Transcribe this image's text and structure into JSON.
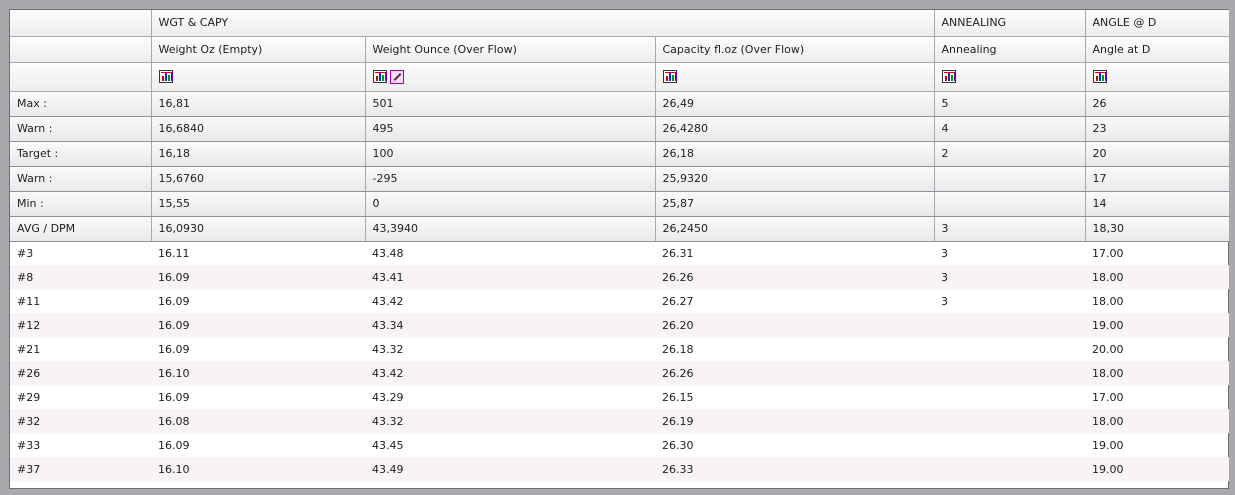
{
  "groups": {
    "wgt": "WGT & CAPY",
    "annealing": "ANNEALING",
    "angle": "ANGLE @ D"
  },
  "columns": [
    "Weight Oz (Empty)",
    "Weight Ounce (Over Flow)",
    "Capacity fl.oz (Over Flow)",
    "Annealing",
    "Angle at D"
  ],
  "icons": {
    "chart": "bar-chart-icon",
    "edit": "edit-notes-icon"
  },
  "stats": [
    {
      "label": "Max :",
      "values": [
        "16,81",
        "501",
        "26,49",
        "5",
        "26"
      ]
    },
    {
      "label": "Warn :",
      "values": [
        "16,6840",
        "495",
        "26,4280",
        "4",
        "23"
      ]
    },
    {
      "label": "Target :",
      "values": [
        "16,18",
        "100",
        "26,18",
        "2",
        "20"
      ]
    },
    {
      "label": "Warn :",
      "values": [
        "15,6760",
        "-295",
        "25,9320",
        "",
        "17"
      ]
    },
    {
      "label": "Min :",
      "values": [
        "15,55",
        "0",
        "25,87",
        "",
        "14"
      ]
    },
    {
      "label": "AVG / DPM",
      "values": [
        "16,0930",
        "43,3940",
        "26,2450",
        "3",
        "18,30"
      ]
    }
  ],
  "rows": [
    {
      "id": "#3",
      "values": [
        "16.11",
        "43.48",
        "26.31",
        "3",
        "17.00"
      ]
    },
    {
      "id": "#8",
      "values": [
        "16.09",
        "43.41",
        "26.26",
        "3",
        "18.00"
      ]
    },
    {
      "id": "#11",
      "values": [
        "16.09",
        "43.42",
        "26.27",
        "3",
        "18.00"
      ]
    },
    {
      "id": "#12",
      "values": [
        "16.09",
        "43.34",
        "26.20",
        "",
        "19.00"
      ]
    },
    {
      "id": "#21",
      "values": [
        "16.09",
        "43.32",
        "26.18",
        "",
        "20.00"
      ]
    },
    {
      "id": "#26",
      "values": [
        "16.10",
        "43.42",
        "26.26",
        "",
        "18.00"
      ]
    },
    {
      "id": "#29",
      "values": [
        "16.09",
        "43.29",
        "26.15",
        "",
        "17.00"
      ]
    },
    {
      "id": "#32",
      "values": [
        "16.08",
        "43.32",
        "26.19",
        "",
        "18.00"
      ]
    },
    {
      "id": "#33",
      "values": [
        "16.09",
        "43.45",
        "26.30",
        "",
        "19.00"
      ]
    },
    {
      "id": "#37",
      "values": [
        "16.10",
        "43.49",
        "26.33",
        "",
        "19.00"
      ]
    }
  ]
}
